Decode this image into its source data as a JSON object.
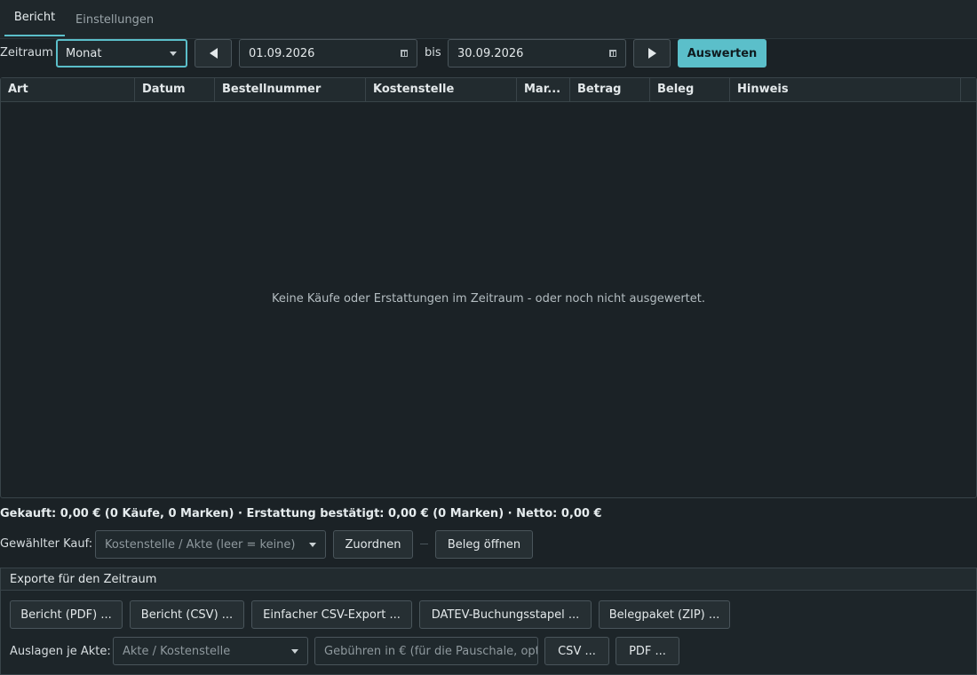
{
  "tabs": {
    "bericht": "Bericht",
    "einstellungen": "Einstellungen"
  },
  "toolbar": {
    "zeitraum_label": "Zeitraum",
    "period_select": "Monat",
    "date_from": "01.09.2026",
    "bis_label": "bis",
    "date_to": "30.09.2026",
    "evaluate_button": "Auswerten"
  },
  "table": {
    "columns": [
      "Art",
      "Datum",
      "Bestellnummer",
      "Kostenstelle",
      "Mar...",
      "Betrag",
      "Beleg",
      "Hinweis"
    ],
    "empty_message": "Keine Käufe oder Erstattungen im Zeitraum - oder noch nicht ausgewertet."
  },
  "summary": "Gekauft: 0,00 € (0 Käufe, 0 Marken) · Erstattung bestätigt: 0,00 € (0 Marken) · Netto: 0,00 €",
  "selected_purchase": {
    "label": "Gewählter Kauf:",
    "select_placeholder": "Kostenstelle / Akte (leer = keine)",
    "assign_button": "Zuordnen",
    "open_receipt_button": "Beleg öffnen"
  },
  "exports": {
    "title": "Exporte für den Zeitraum",
    "buttons": {
      "report_pdf": "Bericht (PDF) ...",
      "report_csv": "Bericht (CSV) ...",
      "simple_csv": "Einfacher CSV-Export ...",
      "datev": "DATEV-Buchungsstapel ...",
      "receipt_zip": "Belegpaket (ZIP) ..."
    },
    "expenses": {
      "label": "Auslagen je Akte:",
      "select_placeholder": "Akte / Kostenstelle",
      "fees_placeholder": "Gebühren in € (für die Pauschale, opt",
      "csv_button": "CSV ...",
      "pdf_button": "PDF ..."
    }
  },
  "colors": {
    "accent": "#5bbfca",
    "background": "#1b2226"
  }
}
